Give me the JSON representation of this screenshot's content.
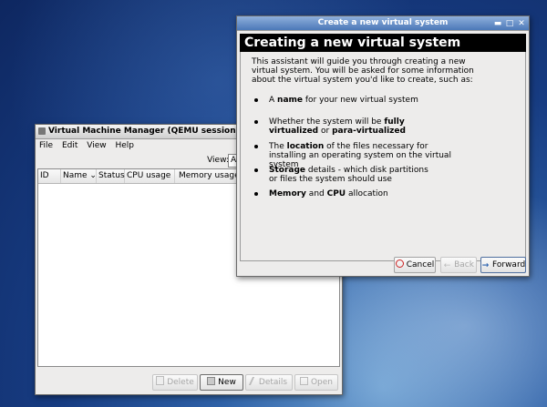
{
  "vmm": {
    "title": "Virtual Machine Manager (QEMU session: local",
    "menu": {
      "file": "File",
      "edit": "Edit",
      "view": "View",
      "help": "Help"
    },
    "view_label": "View:",
    "view_value": "A",
    "columns": [
      "ID",
      "Name ⌄",
      "Status",
      "CPU usage",
      "Memory usage"
    ],
    "buttons": {
      "delete": "Delete",
      "new": "New",
      "details": "Details",
      "open": "Open"
    }
  },
  "wizard": {
    "title": "Create a new virtual system",
    "header": "Creating a new virtual system",
    "intro": "This assistant will guide you through creating a new virtual system. You will be asked for some information about the virtual system you'd like to create, such as:",
    "bullets": [
      {
        "pre": "A ",
        "b1": "name",
        "mid": " for your new virtual system",
        "b2": "",
        "post": ""
      },
      {
        "pre": "Whether the system will be ",
        "b1": "fully virtualized",
        "mid": " or ",
        "b2": "para-virtualized",
        "post": ""
      },
      {
        "pre": "The ",
        "b1": "location",
        "mid": " of the files necessary for installing an operating system on the virtual system",
        "b2": "",
        "post": ""
      },
      {
        "pre": "",
        "b1": "Storage",
        "mid": " details - which disk partitions or files the system should use",
        "b2": "",
        "post": ""
      },
      {
        "pre": "",
        "b1": "Memory",
        "mid": " and ",
        "b2": "CPU",
        "post": " allocation"
      }
    ],
    "buttons": {
      "cancel": "Cancel",
      "back": "Back",
      "forward": "Forward"
    }
  }
}
